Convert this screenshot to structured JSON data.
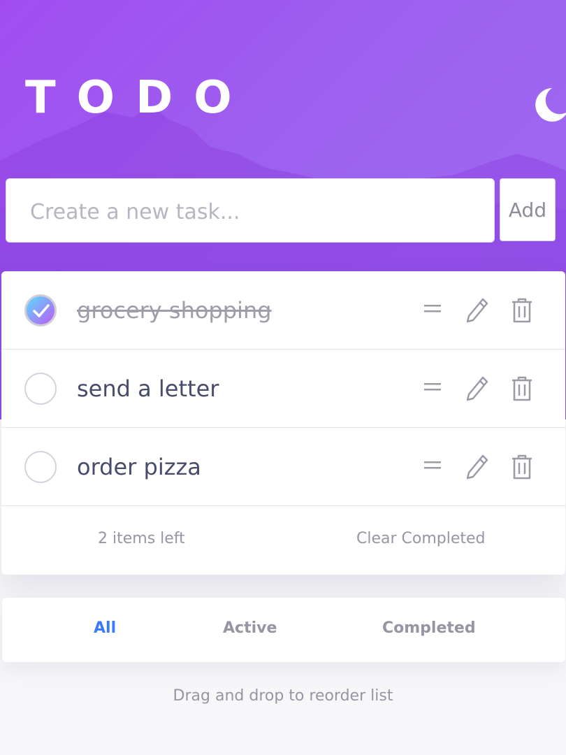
{
  "app": {
    "title": "TODO",
    "theme_icon": "moon-icon"
  },
  "new_task": {
    "placeholder": "Create a new task...",
    "value": "",
    "add_label": "Add"
  },
  "tasks": [
    {
      "text": "grocery shopping",
      "completed": true
    },
    {
      "text": "send a letter",
      "completed": false
    },
    {
      "text": "order pizza",
      "completed": false
    }
  ],
  "task_icons": [
    "drag-handle-icon",
    "pencil-icon",
    "trash-icon"
  ],
  "footer": {
    "items_left": "2 items left",
    "clear_label": "Clear Completed"
  },
  "filters": {
    "all": "All",
    "active": "Active",
    "completed": "Completed",
    "selected": "All"
  },
  "hint": "Drag and drop to reorder list",
  "colors": {
    "accent": "#3a7bfd",
    "check_gradient_start": "#57ddff",
    "check_gradient_end": "#c058f3",
    "header_gradient": "#a24cf0"
  }
}
